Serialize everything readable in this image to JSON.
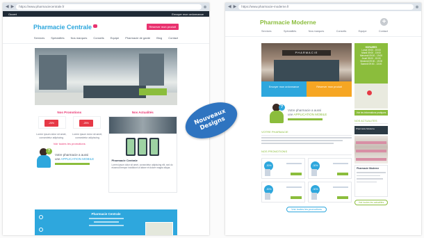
{
  "badge": {
    "line1": "Nouveaux",
    "line2": "Designs"
  },
  "left": {
    "browser": {
      "url": "https://www.pharmaciecentrale.fr"
    },
    "topbar": {
      "left": "Ouvert",
      "right": "Envoyer mon ordonnance"
    },
    "brand": {
      "name": "Pharmacie Centrale"
    },
    "header_cta": "Réserver mon produit",
    "nav": [
      "Services",
      "Spécialités",
      "Nos marques",
      "Conseils",
      "Equipe",
      "Pharmacie de garde",
      "Blog",
      "Contact"
    ],
    "promotions": {
      "title": "Nos Promotions",
      "badge1": "-25%",
      "badge2": "-25%",
      "text1": "Lorem ipsum dolor sit amet, consectetur adipiscing",
      "text2": "Lorem ipsum dolor sit amet, consectetur adipiscing",
      "all": "Voir toutes les promotions"
    },
    "app": {
      "line1": "Votre pharmacie a aussi",
      "line2_prefix": "une",
      "line2_app": "APPLICATION MOBILE"
    },
    "news": {
      "title": "Nos Actualités",
      "card_title": "Pharmacie Centrale",
      "card_body": "Lorem ipsum dolor sit amet, consectetur adipiscing elit, sed do eiusmod tempor incididunt ut labore et dolore magna aliqua."
    },
    "footer": {
      "title": "Pharmacie Centrale"
    }
  },
  "right": {
    "browser": {
      "url": "https://www.pharmacie-moderne.fr"
    },
    "brand": {
      "name": "Pharmacie Moderne"
    },
    "nav": [
      "Services",
      "Spécialités",
      "Nos marques",
      "Conseils",
      "Equipe",
      "Contact"
    ],
    "hero_sign": "PHARMACIE",
    "tiles": {
      "left": "Envoyer mon ordonnance",
      "right": "Réserver mon produit"
    },
    "app": {
      "line1": "Votre pharmacie a aussi",
      "line2_prefix": "une",
      "line2_app": "APPLICATION MOBILE"
    },
    "section_pharmacy": "VOTRE PHARMACIE",
    "section_promos": "NOS PROMOTIONS",
    "promo_prices": [
      "-30%",
      "-30%",
      "-30%",
      "-30%"
    ],
    "all_promos": "Voir toutes les promotions",
    "hours": {
      "title": "HORAIRES",
      "lines": [
        "Lundi 09:00 - 19:00",
        "Mardi 09:00 - 19:00",
        "Mercredi 09:00 - 19:00",
        "Jeudi 09:00 - 19:00",
        "Vendredi 09:00 - 19:00",
        "Samedi 09:00 - 13:00"
      ]
    },
    "map_button": "Voir les informations pratiques",
    "news_title": "NOS ACTUALITES",
    "news_header": "Pharmacie Moderne",
    "card_title": "Pharmacie Moderne",
    "all_news": "Voir toutes les actualités"
  }
}
